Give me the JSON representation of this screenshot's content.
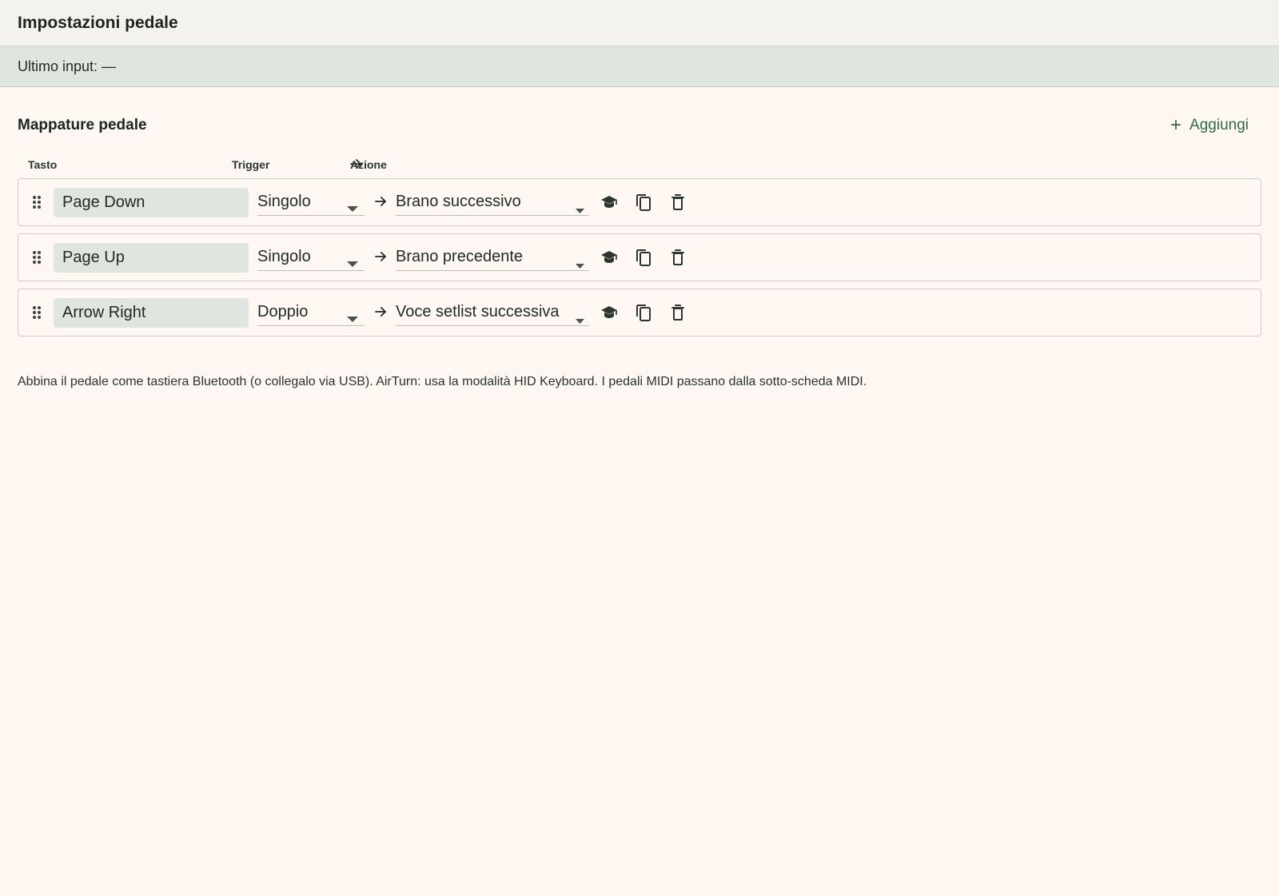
{
  "header": {
    "title": "Impostazioni pedale"
  },
  "status": {
    "label": "Ultimo input:",
    "value": "—"
  },
  "section": {
    "title": "Mappature pedale",
    "add_label": "Aggiungi"
  },
  "columns": {
    "key": "Tasto",
    "trigger": "Trigger",
    "action": "Azione"
  },
  "mappings": [
    {
      "key": "Page Down",
      "trigger": "Singolo",
      "action": "Brano successivo"
    },
    {
      "key": "Page Up",
      "trigger": "Singolo",
      "action": "Brano precedente"
    },
    {
      "key": "Arrow Right",
      "trigger": "Doppio",
      "action": "Voce setlist successiva"
    }
  ],
  "icons": {
    "drag": "drag-handle-icon",
    "arrow": "arrow-right-icon",
    "learn": "school-icon",
    "copy": "copy-icon",
    "delete": "trash-icon",
    "add": "plus-icon",
    "caret": "caret-down-icon"
  },
  "hint": "Abbina il pedale come tastiera Bluetooth (o collegalo via USB). AirTurn: usa la modalità HID Keyboard. I pedali MIDI passano dalla sotto-scheda MIDI.",
  "colors": {
    "background": "#fff8f2",
    "header_bg": "#f3f2ee",
    "status_bg": "#dfe5df",
    "accent": "#2f6a4f"
  }
}
